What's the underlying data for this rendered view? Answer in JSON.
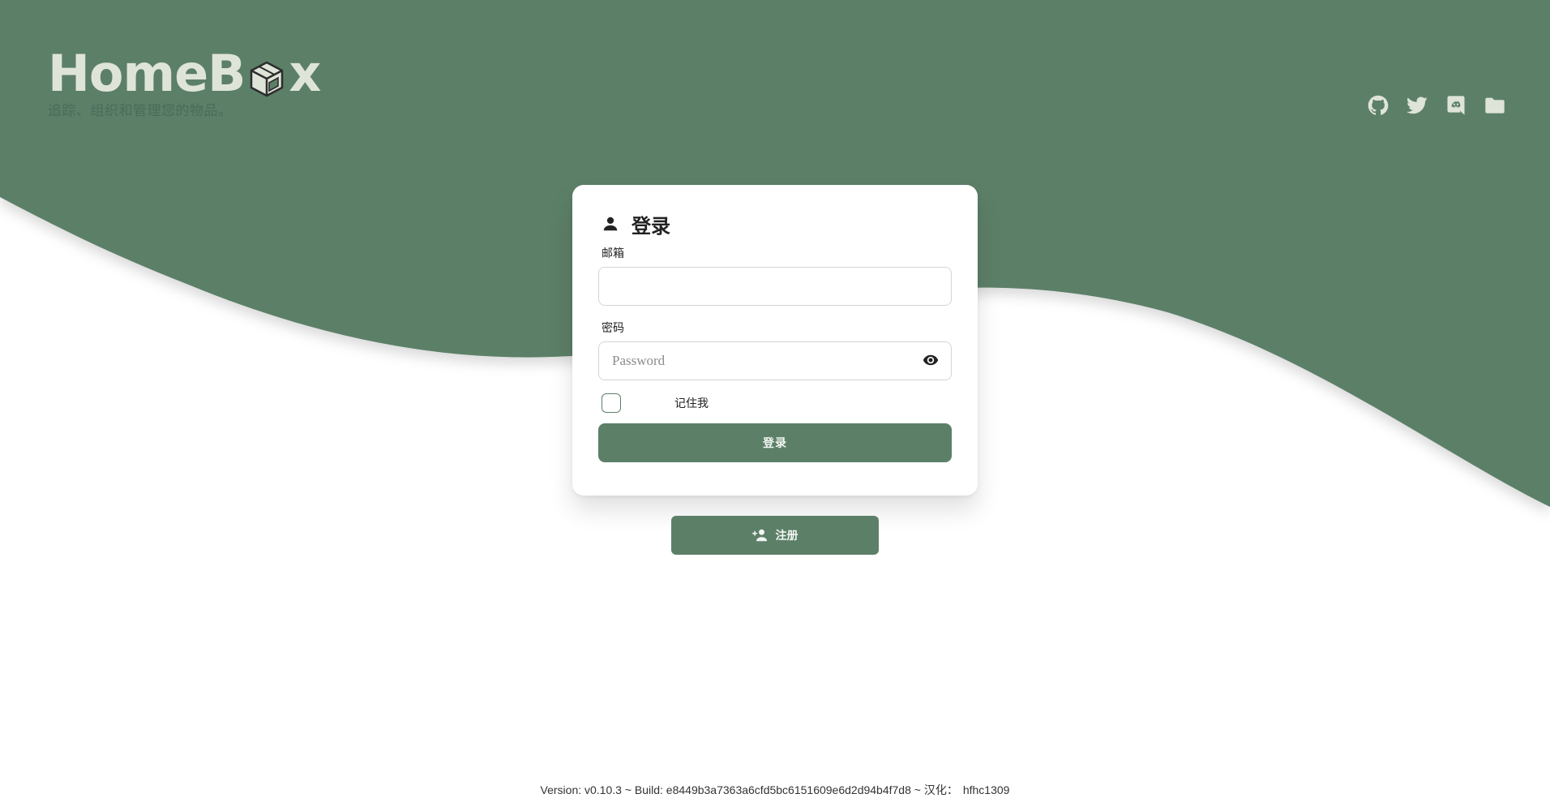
{
  "brand": {
    "name_part1": "HomeB",
    "name_part2": "x",
    "tagline": "追踪、组织和管理您的物品。"
  },
  "social": {
    "icons": [
      "github-icon",
      "twitter-icon",
      "discord-icon",
      "folder-icon"
    ]
  },
  "login": {
    "title": "登录",
    "email_label": "邮箱",
    "email_value": "",
    "password_label": "密码",
    "password_placeholder": "Password",
    "remember_label": "记住我",
    "remember_checked": false,
    "submit_label": "登录"
  },
  "register": {
    "label": "注册"
  },
  "footer": {
    "version": "Version: v0.10.3 ~ Build: e8449b3a7363a6cfd5bc6151609e6d2d94b4f7d8 ~ 汉化：",
    "translator": "hfhc1309"
  },
  "colors": {
    "primary": "#5c7f68",
    "brand_text": "#dfe4d9",
    "background": "#ffffff"
  }
}
